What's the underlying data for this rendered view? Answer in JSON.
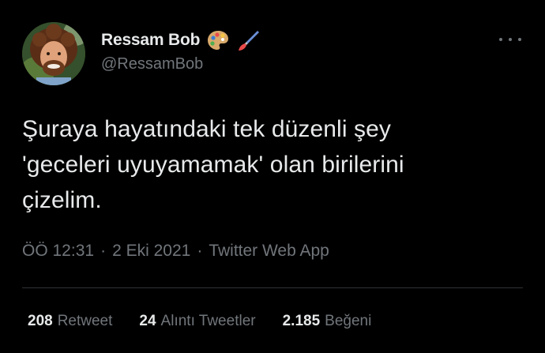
{
  "author": {
    "name": "Ressam Bob",
    "handle": "@RessamBob",
    "name_emojis": [
      "palette-icon",
      "paintbrush-icon"
    ]
  },
  "tweet": {
    "text": "Şuraya hayatındaki tek düzenli şey\n'geceleri uyuyamamak' olan birilerini\nçizelim."
  },
  "meta": {
    "time": "ÖÖ 12:31",
    "separator": "·",
    "date": "2 Eki 2021",
    "source": "Twitter Web App"
  },
  "stats": [
    {
      "count": "208",
      "label": "Retweet"
    },
    {
      "count": "24",
      "label": "Alıntı Tweetler"
    },
    {
      "count": "2.185",
      "label": "Beğeni"
    }
  ],
  "colors": {
    "background": "#000000",
    "primary_text": "#e7e9ea",
    "secondary_text": "#71767b",
    "divider": "#2f3336"
  }
}
